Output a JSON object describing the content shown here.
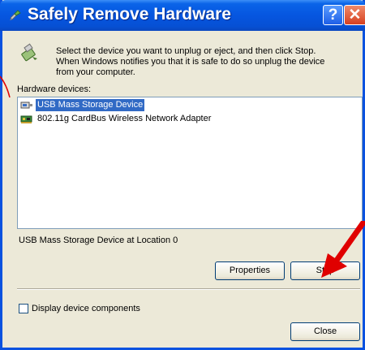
{
  "window": {
    "title": "Safely Remove Hardware",
    "help_glyph": "?",
    "close_glyph": "✕"
  },
  "instructions": "Select the device you want to unplug or eject, and then click Stop. When Windows notifies you that it is safe to do so unplug the device from your computer.",
  "hardware_devices_label": "Hardware devices:",
  "devices": [
    {
      "name": "USB Mass Storage Device",
      "icon": "usb-device-icon",
      "selected": true
    },
    {
      "name": "802.11g CardBus Wireless Network Adapter",
      "icon": "network-adapter-icon",
      "selected": false
    }
  ],
  "location_text": "USB Mass Storage Device at Location 0",
  "buttons": {
    "properties": "Properties",
    "stop": "Stop",
    "close": "Close"
  },
  "checkbox": {
    "label": "Display device components",
    "checked": false
  },
  "colors": {
    "titlebar": "#0656e0",
    "selection": "#316ac5",
    "annotation_arrow": "#e00000"
  }
}
